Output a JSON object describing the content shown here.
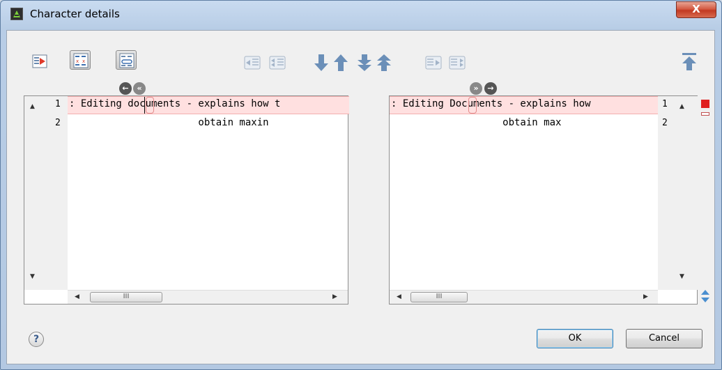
{
  "window": {
    "title": "Character details",
    "close_glyph": "X"
  },
  "toolbar": {
    "icons": [
      "show-diff-icon",
      "word-diff-icon",
      "sync-scroll-icon",
      "copy-change-left-icon",
      "copy-all-left-icon",
      "next-change-icon",
      "previous-change-icon",
      "next-block-icon",
      "previous-block-icon",
      "copy-change-right-icon",
      "copy-all-right-icon",
      "first-change-icon"
    ]
  },
  "left_panel": {
    "lines": [
      {
        "number": "1",
        "text": ": Editing documents - explains how t",
        "changed": true
      },
      {
        "number": "2",
        "text": "                      obtain maxin",
        "changed": false
      }
    ]
  },
  "right_panel": {
    "lines": [
      {
        "number": "1",
        "text": ": Editing Documents - explains how",
        "changed": true
      },
      {
        "number": "2",
        "text": "                   obtain max",
        "changed": false
      }
    ]
  },
  "scroll": {
    "thumb_glyph": "III"
  },
  "footer": {
    "help_label": "?",
    "ok_label": "OK",
    "cancel_label": "Cancel"
  },
  "colors": {
    "change_highlight": "#ffe0e0",
    "change_marker": "#e02020",
    "arrow_blue": "#6b8fb8"
  }
}
